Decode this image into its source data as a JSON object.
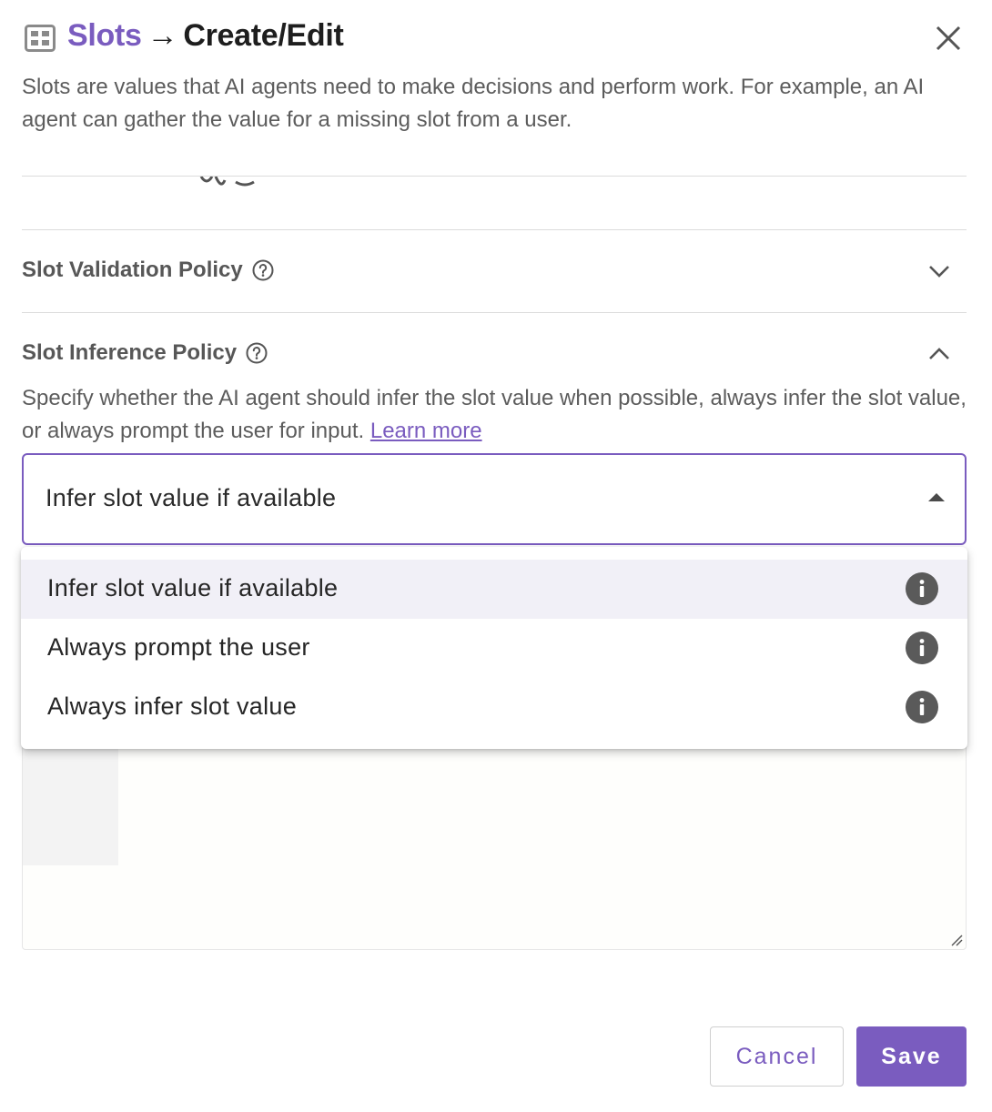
{
  "header": {
    "icon": "slots-grid-icon",
    "breadcrumb": "Slots",
    "separator": "→",
    "page": "Create/Edit",
    "close_icon": "close-icon"
  },
  "description": "Slots are values that AI agents need to make decisions and perform work. For example, an AI agent can gather the value for a missing slot from a user.",
  "sections": {
    "validation": {
      "title": "Slot Validation Policy",
      "state": "collapsed"
    },
    "inference": {
      "title": "Slot Inference Policy",
      "state": "expanded",
      "description": "Specify whether the AI agent should infer the slot value when possible, always infer the slot value, or always prompt the user for input.",
      "learn_more": "Learn more",
      "select": {
        "value": "Infer slot value if available",
        "options": [
          {
            "label": "Infer slot value if available",
            "selected": true
          },
          {
            "label": "Always prompt the user",
            "selected": false
          },
          {
            "label": "Always infer slot value",
            "selected": false
          }
        ]
      }
    }
  },
  "footer": {
    "cancel_label": "Cancel",
    "save_label": "Save"
  },
  "colors": {
    "accent": "#7a5cbf",
    "selected_option_bg": "#f1f0f7"
  }
}
